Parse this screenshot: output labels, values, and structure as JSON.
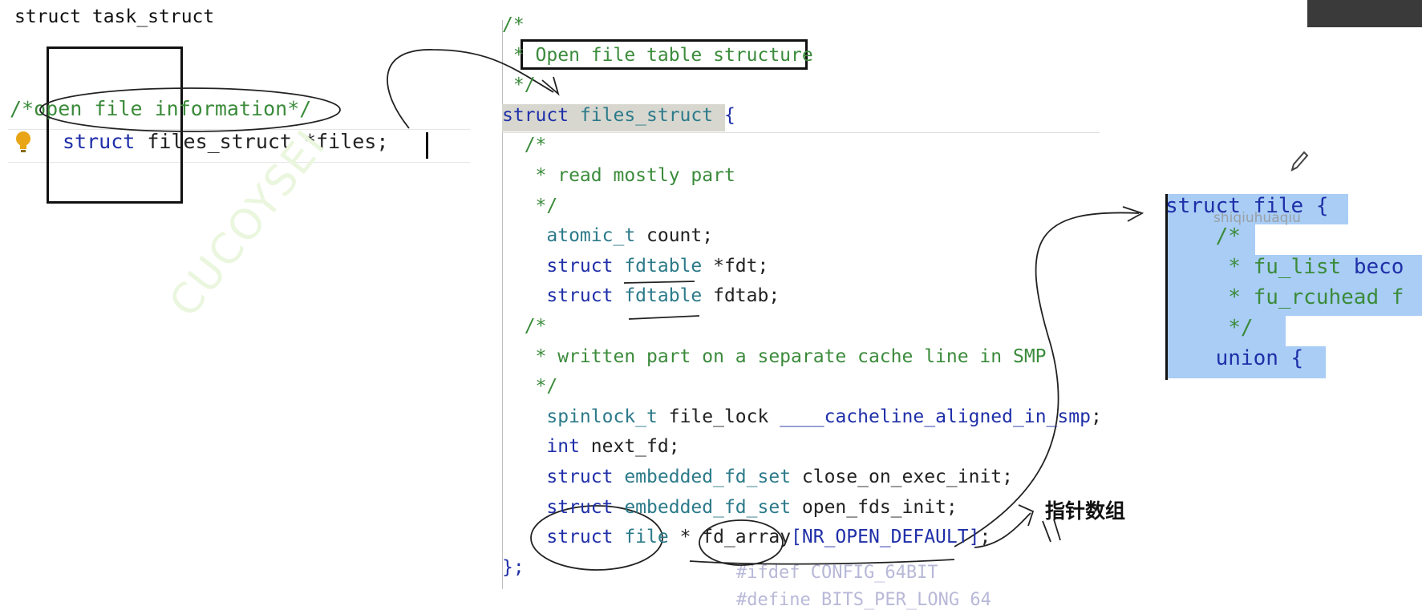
{
  "left": {
    "title": "struct task_struct",
    "comment_open": "/*",
    "comment_text": "open file information",
    "comment_close": "*/",
    "code_kw": "struct",
    "code_rest": " files_struct *files;",
    "watermark": "CUCOYSEI"
  },
  "editor": {
    "lines": [
      {
        "parts": [
          {
            "t": "/*",
            "c": "cm"
          }
        ]
      },
      {
        "parts": [
          {
            "t": " * ",
            "c": "cm"
          },
          {
            "t": "Open file table structure",
            "c": "cm"
          }
        ]
      },
      {
        "parts": [
          {
            "t": " */",
            "c": "cm"
          }
        ]
      },
      {
        "parts": [
          {
            "t": "struct ",
            "c": "kw"
          },
          {
            "t": "files_struct",
            "c": "ty"
          },
          {
            "t": " {",
            "c": "kw"
          }
        ]
      },
      {
        "parts": [
          {
            "t": "  /*",
            "c": "cm"
          }
        ]
      },
      {
        "parts": [
          {
            "t": "   * read mostly part",
            "c": "cm"
          }
        ]
      },
      {
        "parts": [
          {
            "t": "   */",
            "c": "cm"
          }
        ]
      },
      {
        "parts": [
          {
            "t": "    atomic_t",
            "c": "ty"
          },
          {
            "t": " count;",
            "c": "id"
          }
        ]
      },
      {
        "parts": [
          {
            "t": "    struct ",
            "c": "kw"
          },
          {
            "t": "fdtable",
            "c": "ty"
          },
          {
            "t": " *fdt;",
            "c": "id"
          }
        ]
      },
      {
        "parts": [
          {
            "t": "    struct ",
            "c": "kw"
          },
          {
            "t": "fdtable",
            "c": "ty"
          },
          {
            "t": " fdtab;",
            "c": "id"
          }
        ]
      },
      {
        "parts": [
          {
            "t": "  /*",
            "c": "cm"
          }
        ]
      },
      {
        "parts": [
          {
            "t": "   * written part on a separate cache line in SMP",
            "c": "cm"
          }
        ]
      },
      {
        "parts": [
          {
            "t": "   */",
            "c": "cm"
          }
        ]
      },
      {
        "parts": [
          {
            "t": "    spinlock_t",
            "c": "ty"
          },
          {
            "t": " file_lock ",
            "c": "id"
          },
          {
            "t": "____cacheline_aligned_in_smp",
            "c": "kw"
          },
          {
            "t": ";",
            "c": "id"
          }
        ]
      },
      {
        "parts": [
          {
            "t": "    int",
            "c": "kw"
          },
          {
            "t": " next_fd;",
            "c": "id"
          }
        ]
      },
      {
        "parts": [
          {
            "t": "    struct ",
            "c": "kw"
          },
          {
            "t": "embedded_fd_set",
            "c": "ty"
          },
          {
            "t": " close_on_exec_init;",
            "c": "id"
          }
        ]
      },
      {
        "parts": [
          {
            "t": "    struct ",
            "c": "kw"
          },
          {
            "t": "embedded_fd_set",
            "c": "ty"
          },
          {
            "t": " open_fds_init;",
            "c": "id"
          }
        ]
      },
      {
        "parts": [
          {
            "t": "    struct ",
            "c": "kw"
          },
          {
            "t": "file",
            "c": "ty"
          },
          {
            "t": " * fd_array",
            "c": "id"
          },
          {
            "t": "[NR_OPEN_DEFAULT]",
            "c": "kw"
          },
          {
            "t": ";",
            "c": "id"
          }
        ]
      },
      {
        "parts": [
          {
            "t": "};",
            "c": "kw"
          }
        ]
      }
    ],
    "faded_line1": "#ifdef CONFIG_64BIT",
    "faded_line2": "#define BITS_PER_LONG 64"
  },
  "right": {
    "lines": [
      {
        "parts": [
          {
            "t": "struct ",
            "c": "kw"
          },
          {
            "t": "file {",
            "c": "kw"
          }
        ]
      },
      {
        "parts": [
          {
            "t": "    /*",
            "c": "cm"
          }
        ]
      },
      {
        "parts": [
          {
            "t": "     * fu_list ",
            "c": "cm"
          },
          {
            "t": "beco",
            "c": "kw"
          }
        ]
      },
      {
        "parts": [
          {
            "t": "     * fu_rcuhead f",
            "c": "cm"
          }
        ]
      },
      {
        "parts": [
          {
            "t": "     */",
            "c": "cm"
          }
        ]
      },
      {
        "parts": [
          {
            "t": "    union {",
            "c": "kw"
          }
        ]
      }
    ],
    "watermark": "shiqiuhuaqiu"
  },
  "annotation": {
    "label": "指针数组"
  },
  "colors": {
    "keyword": "#1f2fa8",
    "type": "#2c7a8a",
    "comment": "#3b8b3b",
    "selection": "#a9cdf5"
  }
}
